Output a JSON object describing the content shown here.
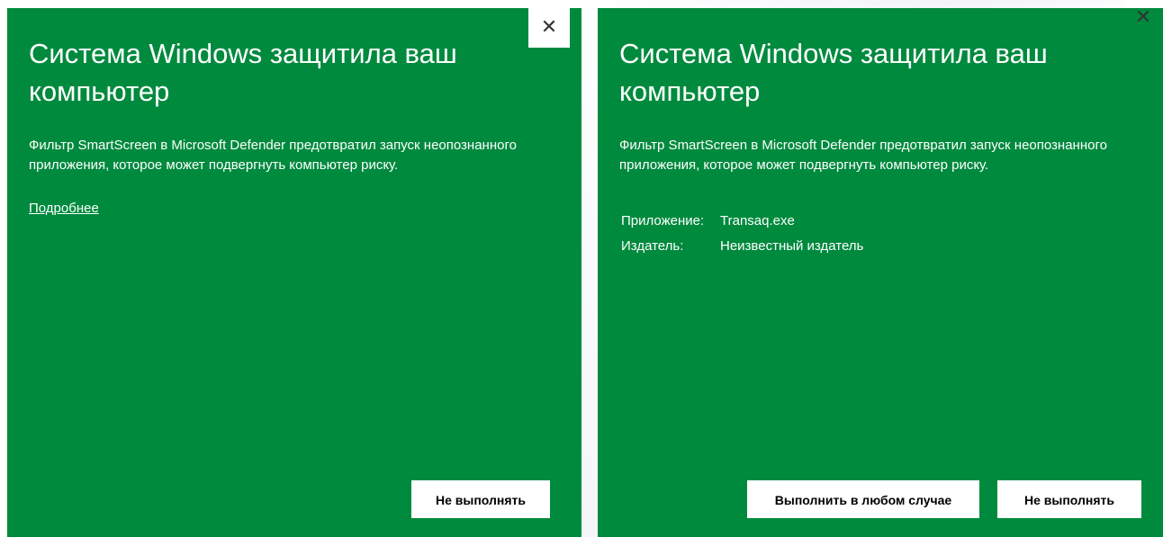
{
  "left_dialog": {
    "title": "Система Windows защитила ваш компьютер",
    "description": "Фильтр SmartScreen в Microsoft Defender предотвратил запуск неопознанного приложения, которое может подвергнуть компьютер риску.",
    "more_link": "Подробнее",
    "close_glyph": "✕",
    "dont_run_label": "Не выполнять"
  },
  "right_dialog": {
    "title": "Система Windows защитила ваш компьютер",
    "description": "Фильтр SmartScreen в Microsoft Defender предотвратил запуск неопознанного приложения, которое может подвергнуть компьютер риску.",
    "app_label": "Приложение:",
    "app_value": "Transaq.exe",
    "publisher_label": "Издатель:",
    "publisher_value": "Неизвестный издатель",
    "close_glyph": "✕",
    "run_anyway_label": "Выполнить в любом случае",
    "dont_run_label": "Не выполнять"
  },
  "colors": {
    "dialog_bg": "#008a3e",
    "text": "#ffffff",
    "button_bg": "#ffffff"
  }
}
